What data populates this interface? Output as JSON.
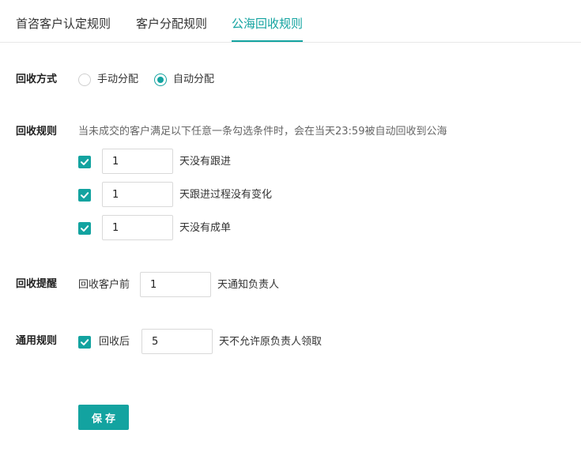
{
  "tabs": [
    {
      "label": "首咨客户认定规则",
      "active": false
    },
    {
      "label": "客户分配规则",
      "active": false
    },
    {
      "label": "公海回收规则",
      "active": true
    }
  ],
  "recycle_method": {
    "label": "回收方式",
    "options": [
      {
        "label": "手动分配",
        "selected": false
      },
      {
        "label": "自动分配",
        "selected": true
      }
    ]
  },
  "recycle_rules": {
    "label": "回收规则",
    "hint": "当未成交的客户满足以下任意一条勾选条件时，会在当天23:59被自动回收到公海",
    "conditions": [
      {
        "checked": true,
        "value": "1",
        "suffix": "天没有跟进"
      },
      {
        "checked": true,
        "value": "1",
        "suffix": "天跟进过程没有变化"
      },
      {
        "checked": true,
        "value": "1",
        "suffix": "天没有成单"
      }
    ]
  },
  "recycle_reminder": {
    "label": "回收提醒",
    "prefix": "回收客户前",
    "value": "1",
    "suffix": "天通知负责人"
  },
  "general_rules": {
    "label": "通用规则",
    "checked": true,
    "prefix": "回收后",
    "value": "5",
    "suffix": "天不允许原负责人领取"
  },
  "save_label": "保存",
  "accent_color": "#13a3a0"
}
